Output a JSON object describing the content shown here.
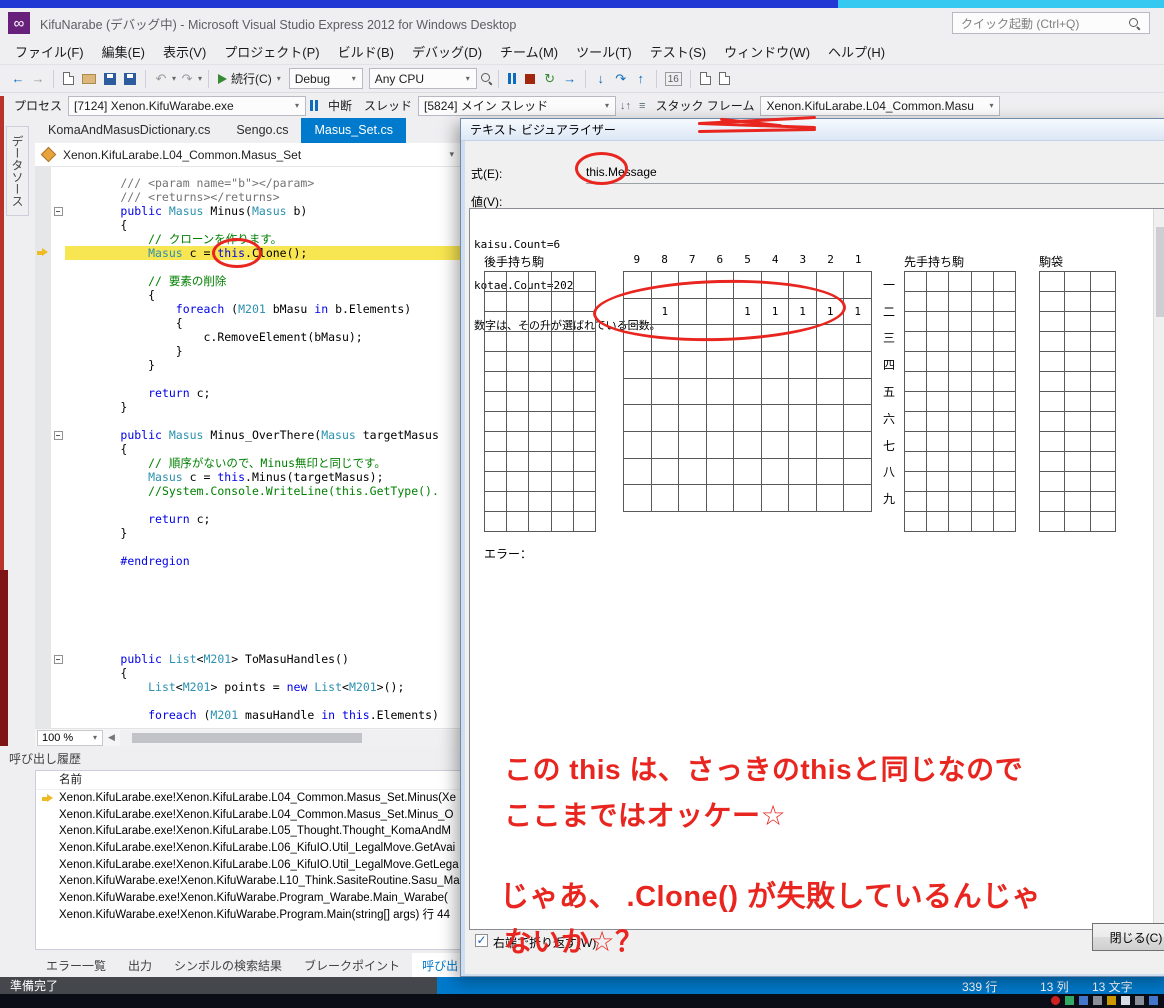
{
  "window": {
    "top_title": "KifuNarabe (デバッグ中) - Microsoft Visual Studio Express 2012 for Windows Desktop",
    "quick_launch_placeholder": "クイック起動 (Ctrl+Q)"
  },
  "menu": {
    "items": [
      "ファイル(F)",
      "編集(E)",
      "表示(V)",
      "プロジェクト(P)",
      "ビルド(B)",
      "デバッグ(D)",
      "チーム(M)",
      "ツール(T)",
      "テスト(S)",
      "ウィンドウ(W)",
      "ヘルプ(H)"
    ]
  },
  "toolbar": {
    "continue_label": "続行(C)",
    "config": "Debug",
    "platform": "Any CPU"
  },
  "debug_bar": {
    "process_label": "プロセス",
    "process_value": "[7124] Xenon.KifuWarabe.exe",
    "break_label": "中断",
    "thread_label": "スレッド",
    "thread_value": "[5824] メイン スレッド",
    "stack_frame_label": "スタック フレーム",
    "stack_frame_value": "Xenon.KifuLarabe.L04_Common.Masu"
  },
  "side_rail": {
    "vertical_tab": "データソース"
  },
  "editor": {
    "tabs": [
      {
        "label": "KomaAndMasusDictionary.cs",
        "active": false
      },
      {
        "label": "Sengo.cs",
        "active": false
      },
      {
        "label": "Masus_Set.cs",
        "active": true
      }
    ],
    "breadcrumb": "Xenon.KifuLarabe.L04_Common.Masus_Set",
    "zoom_value": "100 %",
    "code_lines": [
      {
        "s": [
          [
            "        /// <param name=\"b\"></param>",
            "g"
          ]
        ]
      },
      {
        "s": [
          [
            "        /// <returns></returns>",
            "g"
          ]
        ]
      },
      {
        "f": true,
        "s": [
          [
            "        ",
            "p"
          ],
          [
            "public ",
            "k"
          ],
          [
            "Masus",
            "t"
          ],
          [
            " Minus(",
            "p"
          ],
          [
            "Masus",
            "t"
          ],
          [
            " b)",
            "p"
          ]
        ]
      },
      {
        "s": [
          [
            "        {",
            "p"
          ]
        ]
      },
      {
        "s": [
          [
            "            ",
            "p"
          ],
          [
            "// クローンを作ります。",
            "c"
          ]
        ]
      },
      {
        "h": true,
        "m": true,
        "s": [
          [
            "            ",
            "p"
          ],
          [
            "Masus",
            "t"
          ],
          [
            " c = ",
            "p"
          ],
          [
            "this",
            "k"
          ],
          [
            ".Clone();",
            "p"
          ]
        ]
      },
      {
        "s": []
      },
      {
        "s": [
          [
            "            ",
            "p"
          ],
          [
            "// 要素の削除",
            "c"
          ]
        ]
      },
      {
        "s": [
          [
            "            {",
            "p"
          ]
        ]
      },
      {
        "s": [
          [
            "                ",
            "p"
          ],
          [
            "foreach",
            "k"
          ],
          [
            " (",
            "p"
          ],
          [
            "M201",
            "t"
          ],
          [
            " bMasu ",
            "p"
          ],
          [
            "in",
            "k"
          ],
          [
            " b.Elements)",
            "p"
          ]
        ]
      },
      {
        "s": [
          [
            "                {",
            "p"
          ]
        ]
      },
      {
        "s": [
          [
            "                    c.RemoveElement(bMasu);",
            "p"
          ]
        ]
      },
      {
        "s": [
          [
            "                }",
            "p"
          ]
        ]
      },
      {
        "s": [
          [
            "            }",
            "p"
          ]
        ]
      },
      {
        "s": []
      },
      {
        "s": [
          [
            "            ",
            "p"
          ],
          [
            "return",
            "k"
          ],
          [
            " c;",
            "p"
          ]
        ]
      },
      {
        "s": [
          [
            "        }",
            "p"
          ]
        ]
      },
      {
        "s": []
      },
      {
        "f": true,
        "s": [
          [
            "        ",
            "p"
          ],
          [
            "public ",
            "k"
          ],
          [
            "Masus",
            "t"
          ],
          [
            " Minus_OverThere(",
            "p"
          ],
          [
            "Masus",
            "t"
          ],
          [
            " targetMasus",
            "p"
          ]
        ]
      },
      {
        "s": [
          [
            "        {",
            "p"
          ]
        ]
      },
      {
        "s": [
          [
            "            ",
            "p"
          ],
          [
            "// 順序がないので、Minus無印と同じです。",
            "c"
          ]
        ]
      },
      {
        "s": [
          [
            "            ",
            "p"
          ],
          [
            "Masus",
            "t"
          ],
          [
            " c = ",
            "p"
          ],
          [
            "this",
            "k"
          ],
          [
            ".Minus(targetMasus);",
            "p"
          ]
        ]
      },
      {
        "s": [
          [
            "            ",
            "p"
          ],
          [
            "//System.Console.WriteLine(this.GetType().",
            "c"
          ]
        ]
      },
      {
        "s": []
      },
      {
        "s": [
          [
            "            ",
            "p"
          ],
          [
            "return",
            "k"
          ],
          [
            " c;",
            "p"
          ]
        ]
      },
      {
        "s": [
          [
            "        }",
            "p"
          ]
        ]
      },
      {
        "s": []
      },
      {
        "s": [
          [
            "        ",
            "p"
          ],
          [
            "#endregion",
            "k"
          ]
        ]
      },
      {
        "s": []
      },
      {
        "s": []
      },
      {
        "s": []
      },
      {
        "s": []
      },
      {
        "s": []
      },
      {
        "s": []
      },
      {
        "f": true,
        "s": [
          [
            "        ",
            "p"
          ],
          [
            "public ",
            "k"
          ],
          [
            "List",
            "t"
          ],
          [
            "<",
            "p"
          ],
          [
            "M201",
            "t"
          ],
          [
            "> ToMasuHandles()",
            "p"
          ]
        ]
      },
      {
        "s": [
          [
            "        {",
            "p"
          ]
        ]
      },
      {
        "s": [
          [
            "            ",
            "p"
          ],
          [
            "List",
            "t"
          ],
          [
            "<",
            "p"
          ],
          [
            "M201",
            "t"
          ],
          [
            "> points = ",
            "p"
          ],
          [
            "new",
            "k"
          ],
          [
            " ",
            "p"
          ],
          [
            "List",
            "t"
          ],
          [
            "<",
            "p"
          ],
          [
            "M201",
            "t"
          ],
          [
            ">();",
            "p"
          ]
        ]
      },
      {
        "s": []
      },
      {
        "s": [
          [
            "            ",
            "p"
          ],
          [
            "foreach",
            "k"
          ],
          [
            " (",
            "p"
          ],
          [
            "M201",
            "t"
          ],
          [
            " masuHandle ",
            "p"
          ],
          [
            "in",
            "k"
          ],
          [
            " ",
            "p"
          ],
          [
            "this",
            "k"
          ],
          [
            ".Elements)",
            "p"
          ]
        ]
      }
    ]
  },
  "call_stack": {
    "panel_title": "呼び出し履歴",
    "column_header": "名前",
    "rows": [
      {
        "arrow": true,
        "text": "Xenon.KifuLarabe.exe!Xenon.KifuLarabe.L04_Common.Masus_Set.Minus(Xe"
      },
      {
        "arrow": false,
        "text": "Xenon.KifuLarabe.exe!Xenon.KifuLarabe.L04_Common.Masus_Set.Minus_O"
      },
      {
        "arrow": false,
        "text": "Xenon.KifuLarabe.exe!Xenon.KifuLarabe.L05_Thought.Thought_KomaAndM"
      },
      {
        "arrow": false,
        "text": "Xenon.KifuLarabe.exe!Xenon.KifuLarabe.L06_KifuIO.Util_LegalMove.GetAvai"
      },
      {
        "arrow": false,
        "text": "Xenon.KifuLarabe.exe!Xenon.KifuLarabe.L06_KifuIO.Util_LegalMove.GetLega"
      },
      {
        "arrow": false,
        "text": "Xenon.KifuWarabe.exe!Xenon.KifuWarabe.L10_Think.SasiteRoutine.Sasu_Ma"
      },
      {
        "arrow": false,
        "text": "Xenon.KifuWarabe.exe!Xenon.KifuWarabe.Program_Warabe.Main_Warabe("
      },
      {
        "arrow": false,
        "text": "Xenon.KifuWarabe.exe!Xenon.KifuWarabe.Program.Main(string[] args) 行 44"
      }
    ]
  },
  "bottom_tabs": {
    "items": [
      {
        "label": "エラー一覧",
        "active": false
      },
      {
        "label": "出力",
        "active": false
      },
      {
        "label": "シンボルの検索結果",
        "active": false
      },
      {
        "label": "ブレークポイント",
        "active": false
      },
      {
        "label": "呼び出し履歴",
        "active": true
      }
    ]
  },
  "status_bar": {
    "ready": "準備完了",
    "line_count": "339 行",
    "column_pos": "13 列",
    "char_pos": "13 文字"
  },
  "visualizer_dialog": {
    "title": "テキスト ビジュアライザー",
    "expression_label": "式(E):",
    "expression_value": "this.Message",
    "value_label": "値(V):",
    "text_lines": [
      "kaisu.Count=6",
      "kotae.Count=202",
      "数字は、その升が選ばれている回数。"
    ],
    "board": {
      "gote_label": "後手持ち駒",
      "sente_label": "先手持ち駒",
      "bag_label": "駒袋",
      "col_labels": [
        "9",
        "8",
        "7",
        "6",
        "5",
        "4",
        "3",
        "2",
        "1"
      ],
      "row_labels": [
        "一",
        "二",
        "三",
        "四",
        "五",
        "六",
        "七",
        "八",
        "九"
      ],
      "cells": [
        [
          "",
          "",
          "",
          "",
          "",
          "",
          "",
          "",
          ""
        ],
        [
          "",
          "1",
          "",
          "",
          "1",
          "1",
          "1",
          "1",
          "1"
        ],
        [
          "",
          "",
          "",
          "",
          "",
          "",
          "",
          "",
          ""
        ],
        [
          "",
          "",
          "",
          "",
          "",
          "",
          "",
          "",
          ""
        ],
        [
          "",
          "",
          "",
          "",
          "",
          "",
          "",
          "",
          ""
        ],
        [
          "",
          "",
          "",
          "",
          "",
          "",
          "",
          "",
          ""
        ],
        [
          "",
          "",
          "",
          "",
          "",
          "",
          "",
          "",
          ""
        ],
        [
          "",
          "",
          "",
          "",
          "",
          "",
          "",
          "",
          ""
        ],
        [
          "",
          "",
          "",
          "",
          "",
          "",
          "",
          "",
          ""
        ]
      ],
      "gote_grid": {
        "cols": 5,
        "rows": 13
      },
      "sente_grid": {
        "cols": 5,
        "rows": 13
      },
      "bag_grid": {
        "cols": 3,
        "rows": 13
      }
    },
    "error_label": "エラー：",
    "wrap_checkbox_label": "右端で折り返す(W)",
    "wrap_checked": true,
    "close_button": "閉じる(C)"
  },
  "annotations": {
    "ink_color": "#e8251f",
    "lines": [
      "この this は、さっきのthisと同じなので",
      "ここまではオッケー☆",
      "じゃあ、 .Clone() が失敗しているんじゃ",
      "ないか☆？"
    ]
  }
}
